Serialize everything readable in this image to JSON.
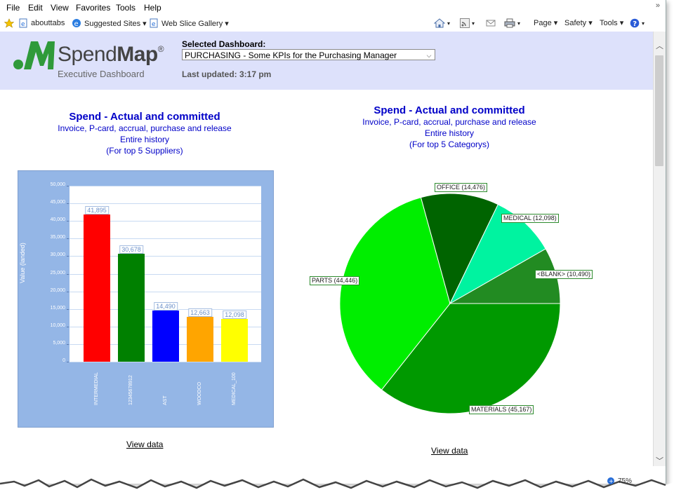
{
  "menu": [
    "File",
    "Edit",
    "View",
    "Favorites",
    "Tools",
    "Help"
  ],
  "menu_overflow": "»",
  "favorites": {
    "star_icon": "star-icon",
    "items": [
      "abouttabs",
      "Suggested Sites ▾",
      "Web Slice Gallery ▾"
    ]
  },
  "command_bar": {
    "page": "Page ▾",
    "safety": "Safety ▾",
    "tools": "Tools ▾",
    "help": "▾"
  },
  "header": {
    "brand_regular": "Spend",
    "brand_bold": "Map",
    "registered": "®",
    "subtitle": "Executive Dashboard",
    "selected_label": "Selected Dashboard:",
    "selected_value": "PURCHASING - Some KPIs for the Purchasing Manager",
    "last_updated": "Last updated:  3:17 pm"
  },
  "left_chart": {
    "title": "Spend - Actual and committed",
    "line2": "Invoice, P-card, accrual, purchase and release",
    "line3": "Entire history",
    "line4": "(For top 5 Suppliers)",
    "view_data": "View data"
  },
  "right_chart": {
    "title": "Spend - Actual and committed",
    "line2": "Invoice, P-card, accrual, purchase and release",
    "line3": "Entire history",
    "line4": "(For top 5 Categorys)",
    "view_data": "View data"
  },
  "status": {
    "zoom": "75%"
  },
  "colors": {
    "header_bg": "#dde1fb",
    "title_blue": "#0000c8",
    "panel_bg": "#94b6e6"
  },
  "chart_data": [
    {
      "type": "bar",
      "ylabel": "Value (landed)",
      "ylim": [
        0,
        50000
      ],
      "yticks": [
        "0",
        "5,000",
        "10,000",
        "15,000",
        "20,000",
        "25,000",
        "30,000",
        "35,000",
        "40,000",
        "45,000",
        "50,000"
      ],
      "categories": [
        "INTERMEDIAL",
        "12345678912",
        "AST",
        "WOODCO",
        "MEDICAL_100"
      ],
      "values": [
        41895,
        30678,
        14490,
        12663,
        12098
      ],
      "value_labels": [
        "41,895",
        "30,678",
        "14,490",
        "12,663",
        "12,098"
      ],
      "bar_colors": [
        "#ff0000",
        "#008000",
        "#0000ff",
        "#ffa500",
        "#ffff00"
      ],
      "grid": true
    },
    {
      "type": "pie",
      "categories": [
        "MATERIALS",
        "PARTS",
        "OFFICE",
        "MEDICAL",
        "<BLANK>"
      ],
      "values": [
        45167,
        44446,
        14476,
        12098,
        10490
      ],
      "labels": [
        "MATERIALS (45,167)",
        "PARTS (44,446)",
        "OFFICE (14,476)",
        "MEDICAL (12,098)",
        "<BLANK> (10,490)"
      ],
      "slice_colors": [
        "#009900",
        "#00ee00",
        "#006400",
        "#00f3a0",
        "#228b22"
      ]
    }
  ]
}
